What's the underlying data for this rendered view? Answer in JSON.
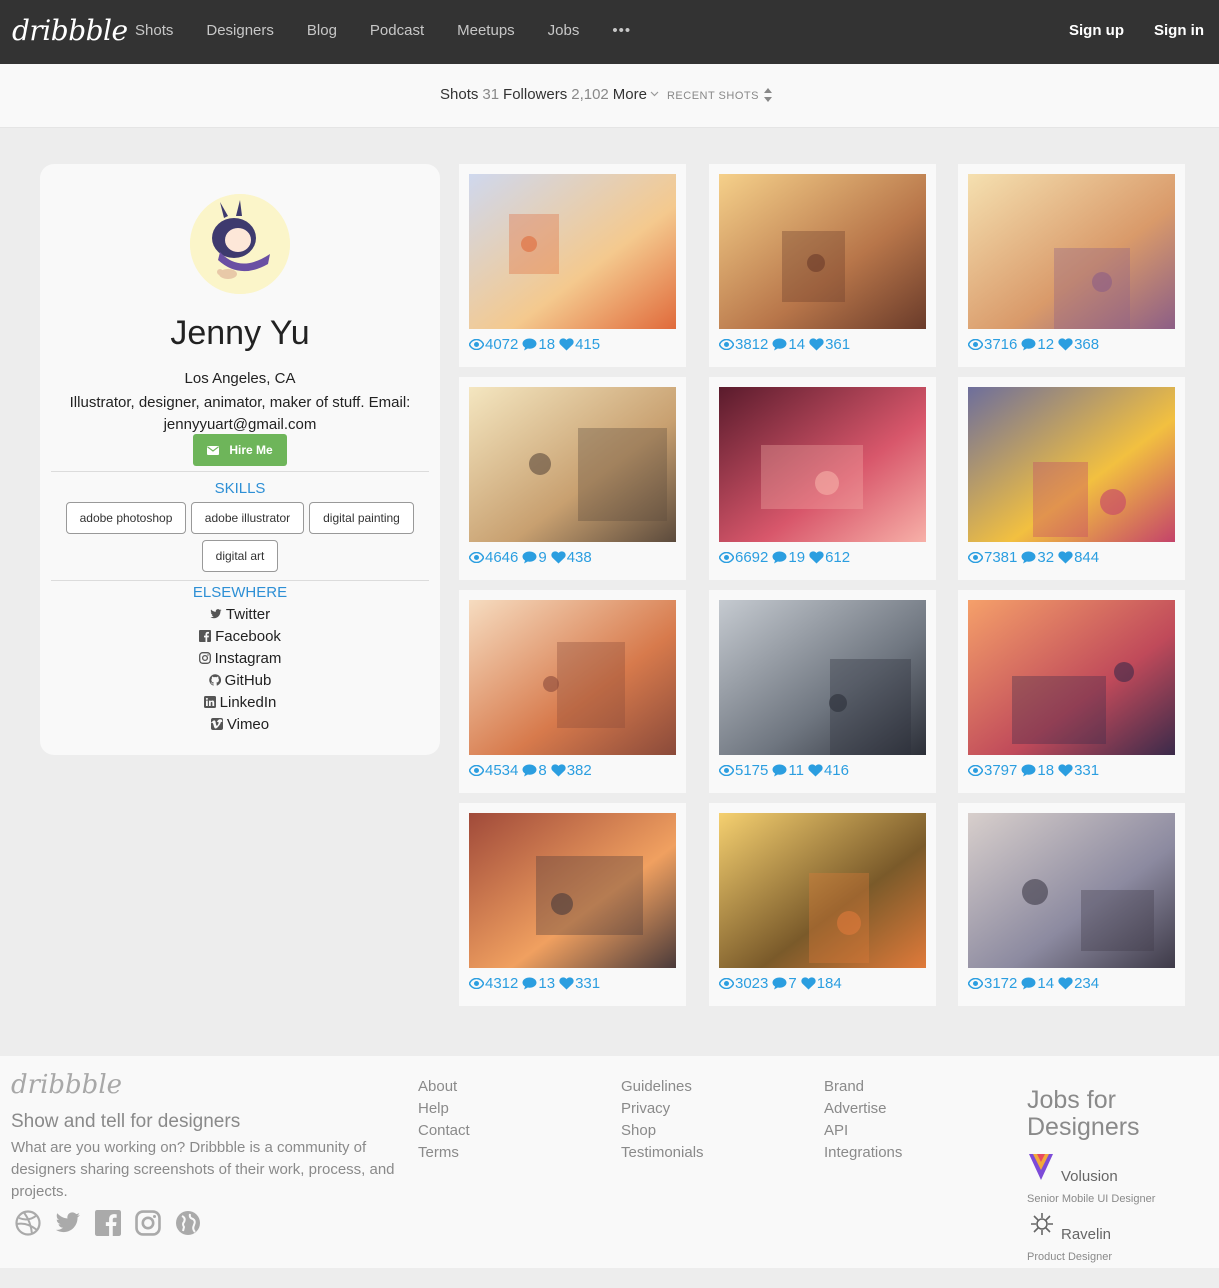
{
  "nav": {
    "logo": "dribbble",
    "links": [
      "Shots",
      "Designers",
      "Blog",
      "Podcast",
      "Meetups",
      "Jobs"
    ],
    "more": "•••",
    "signup": "Sign up",
    "signin": "Sign in"
  },
  "subnav": {
    "shots_label": "Shots",
    "shots_count": "31",
    "followers_label": "Followers",
    "followers_count": "2,102",
    "more_label": "More",
    "sort_label": "RECENT SHOTS"
  },
  "profile": {
    "name": "Jenny Yu",
    "location": "Los Angeles, CA",
    "bio": "Illustrator, designer, animator, maker of stuff. Email: jennyyuart@gmail.com",
    "hire_label": "Hire Me",
    "skills_title": "SKILLS",
    "skills": [
      "adobe photoshop",
      "adobe illustrator",
      "digital painting",
      "digital art"
    ],
    "elsewhere_title": "ELSEWHERE",
    "social": [
      {
        "label": "Twitter",
        "icon": "twitter-icon"
      },
      {
        "label": "Facebook",
        "icon": "facebook-icon"
      },
      {
        "label": "Instagram",
        "icon": "instagram-icon"
      },
      {
        "label": "GitHub",
        "icon": "github-icon"
      },
      {
        "label": "LinkedIn",
        "icon": "linkedin-icon"
      },
      {
        "label": "Vimeo",
        "icon": "vimeo-icon"
      }
    ]
  },
  "shots": [
    {
      "views": "4072",
      "comments": "18",
      "likes": "415"
    },
    {
      "views": "3812",
      "comments": "14",
      "likes": "361"
    },
    {
      "views": "3716",
      "comments": "12",
      "likes": "368"
    },
    {
      "views": "4646",
      "comments": "9",
      "likes": "438"
    },
    {
      "views": "6692",
      "comments": "19",
      "likes": "612"
    },
    {
      "views": "7381",
      "comments": "32",
      "likes": "844"
    },
    {
      "views": "4534",
      "comments": "8",
      "likes": "382"
    },
    {
      "views": "5175",
      "comments": "11",
      "likes": "416"
    },
    {
      "views": "3797",
      "comments": "18",
      "likes": "331"
    },
    {
      "views": "4312",
      "comments": "13",
      "likes": "331"
    },
    {
      "views": "3023",
      "comments": "7",
      "likes": "184"
    },
    {
      "views": "3172",
      "comments": "14",
      "likes": "234"
    }
  ],
  "footer": {
    "logo": "dribbble",
    "tagline": "Show and tell for designers",
    "description": "What are you working on? Dribbble is a community of designers sharing screenshots of their work, process, and projects.",
    "col1": [
      "About",
      "Help",
      "Contact",
      "Terms"
    ],
    "col2": [
      "Guidelines",
      "Privacy",
      "Shop",
      "Testimonials"
    ],
    "col3": [
      "Brand",
      "Advertise",
      "API",
      "Integrations"
    ],
    "jobs_title": "Jobs for Designers",
    "jobs": [
      {
        "company": "Volusion",
        "role": "Senior Mobile UI Designer"
      },
      {
        "company": "Ravelin",
        "role": "Product Designer"
      }
    ]
  },
  "colors": {
    "accent": "#2b9ee0",
    "hire": "#6eb55a",
    "nav_bg": "#333333"
  }
}
